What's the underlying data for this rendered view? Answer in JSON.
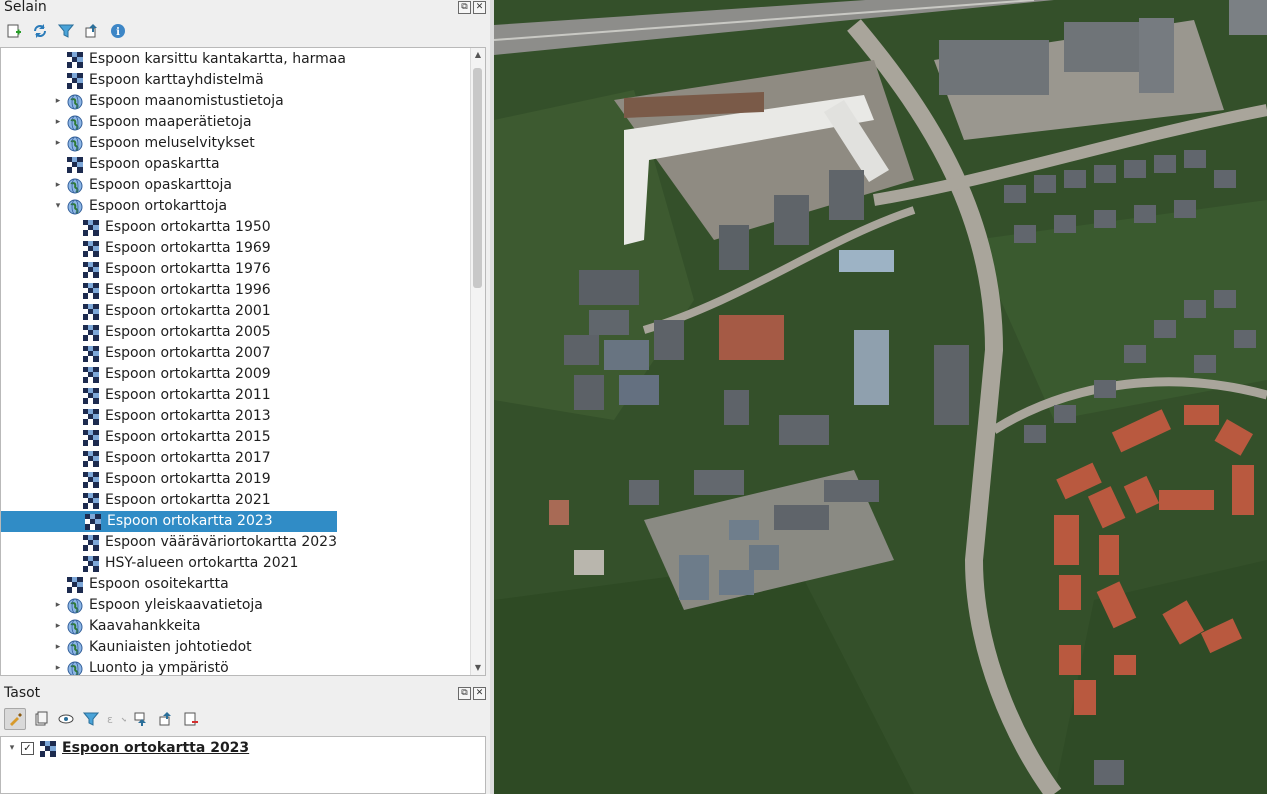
{
  "browser_panel": {
    "title": "Selain",
    "items": [
      {
        "label": "Espoon karsittu kantakartta, harmaa",
        "type": "raster",
        "level": 1,
        "expander": ""
      },
      {
        "label": "Espoon karttayhdistelmä",
        "type": "raster",
        "level": 1,
        "expander": ""
      },
      {
        "label": "Espoon maanomistustietoja",
        "type": "globe",
        "level": 1,
        "expander": "▸"
      },
      {
        "label": "Espoon maaperätietoja",
        "type": "globe",
        "level": 1,
        "expander": "▸"
      },
      {
        "label": "Espoon meluselvitykset",
        "type": "globe",
        "level": 1,
        "expander": "▸"
      },
      {
        "label": "Espoon opaskartta",
        "type": "raster",
        "level": 1,
        "expander": ""
      },
      {
        "label": "Espoon opaskarttoja",
        "type": "globe",
        "level": 1,
        "expander": "▸"
      },
      {
        "label": "Espoon ortokarttoja",
        "type": "globe",
        "level": 1,
        "expander": "▾"
      },
      {
        "label": "Espoon ortokartta 1950",
        "type": "raster",
        "level": 2,
        "expander": ""
      },
      {
        "label": "Espoon ortokartta 1969",
        "type": "raster",
        "level": 2,
        "expander": ""
      },
      {
        "label": "Espoon ortokartta 1976",
        "type": "raster",
        "level": 2,
        "expander": ""
      },
      {
        "label": "Espoon ortokartta 1996",
        "type": "raster",
        "level": 2,
        "expander": ""
      },
      {
        "label": "Espoon ortokartta 2001",
        "type": "raster",
        "level": 2,
        "expander": ""
      },
      {
        "label": "Espoon ortokartta 2005",
        "type": "raster",
        "level": 2,
        "expander": ""
      },
      {
        "label": "Espoon ortokartta 2007",
        "type": "raster",
        "level": 2,
        "expander": ""
      },
      {
        "label": "Espoon ortokartta 2009",
        "type": "raster",
        "level": 2,
        "expander": ""
      },
      {
        "label": "Espoon ortokartta 2011",
        "type": "raster",
        "level": 2,
        "expander": ""
      },
      {
        "label": "Espoon ortokartta 2013",
        "type": "raster",
        "level": 2,
        "expander": ""
      },
      {
        "label": "Espoon ortokartta 2015",
        "type": "raster",
        "level": 2,
        "expander": ""
      },
      {
        "label": "Espoon ortokartta 2017",
        "type": "raster",
        "level": 2,
        "expander": ""
      },
      {
        "label": "Espoon ortokartta 2019",
        "type": "raster",
        "level": 2,
        "expander": ""
      },
      {
        "label": "Espoon ortokartta 2021",
        "type": "raster",
        "level": 2,
        "expander": ""
      },
      {
        "label": "Espoon ortokartta 2023",
        "type": "raster",
        "level": 2,
        "expander": "",
        "selected": true
      },
      {
        "label": "Espoon vääräväriortokartta 2023",
        "type": "raster",
        "level": 2,
        "expander": ""
      },
      {
        "label": "HSY-alueen ortokartta 2021",
        "type": "raster",
        "level": 2,
        "expander": ""
      },
      {
        "label": "Espoon osoitekartta",
        "type": "raster",
        "level": 1,
        "expander": ""
      },
      {
        "label": "Espoon yleiskaavatietoja",
        "type": "globe",
        "level": 1,
        "expander": "▸"
      },
      {
        "label": "Kaavahankkeita",
        "type": "globe",
        "level": 1,
        "expander": "▸"
      },
      {
        "label": "Kauniaisten johtotiedot",
        "type": "globe",
        "level": 1,
        "expander": "▸"
      },
      {
        "label": "Luonto ja ympäristö",
        "type": "globe",
        "level": 1,
        "expander": "▸"
      }
    ]
  },
  "layers_panel": {
    "title": "Tasot",
    "layers": [
      {
        "label": "Espoon ortokartta 2023",
        "checked": true
      }
    ]
  },
  "colors": {
    "selection": "#308cc6",
    "forest": "#2f4a25"
  }
}
